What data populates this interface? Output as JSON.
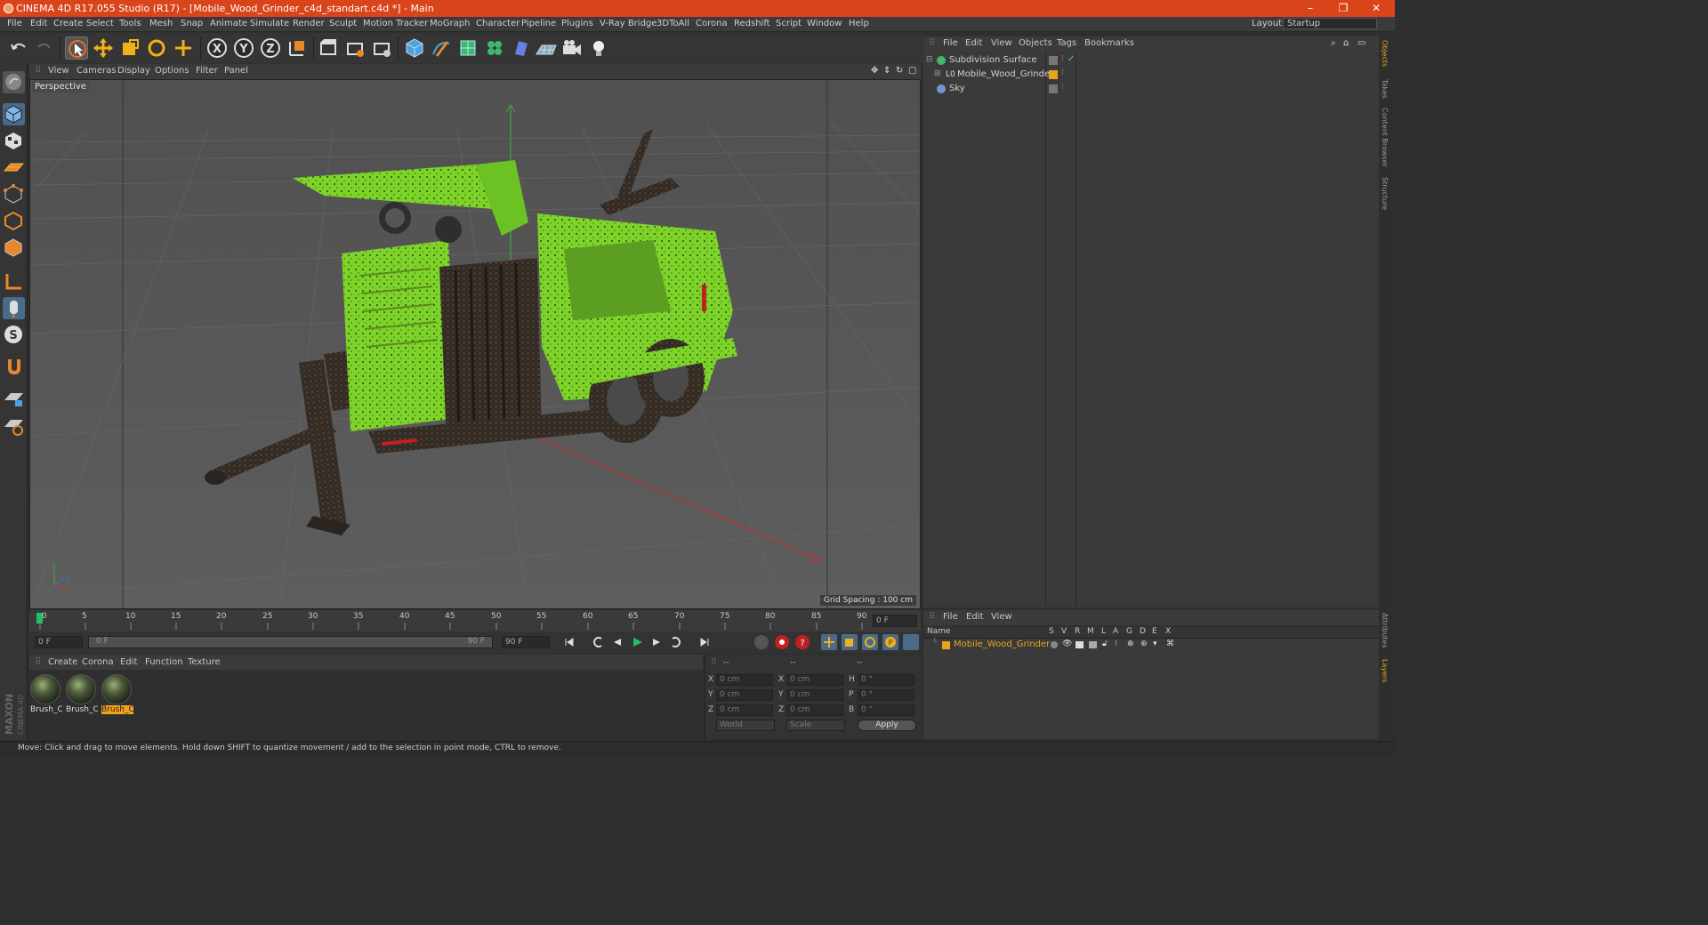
{
  "window": {
    "title": "CINEMA 4D R17.055 Studio (R17) - [Mobile_Wood_Grinder_c4d_standart.c4d *] - Main",
    "controls": [
      "–",
      "❐",
      "✕"
    ]
  },
  "menubar": {
    "items": [
      "File",
      "Edit",
      "Create",
      "Select",
      "Tools",
      "Mesh",
      "Snap",
      "Animate",
      "Simulate",
      "Render",
      "Sculpt",
      "Motion Tracker",
      "MoGraph",
      "Character",
      "Pipeline",
      "Plugins",
      "V-Ray Bridge",
      "3DToAll",
      "Corona",
      "Redshift",
      "Script",
      "Window",
      "Help"
    ],
    "layout_label": "Layout:",
    "layout_value": "Startup"
  },
  "toolbar": {
    "axis_x": "X",
    "axis_y": "Y",
    "axis_z": "Z"
  },
  "viewport": {
    "menu": [
      "View",
      "Cameras",
      "Display",
      "Options",
      "Filter",
      "Panel"
    ],
    "camera_label": "Perspective",
    "grid_spacing": "Grid Spacing : 100 cm"
  },
  "timeline": {
    "ticks": [
      "0",
      "5",
      "10",
      "15",
      "20",
      "25",
      "30",
      "35",
      "40",
      "45",
      "50",
      "55",
      "60",
      "65",
      "70",
      "75",
      "80",
      "85",
      "90"
    ],
    "current_frame_field": "0 F",
    "start_field": "0 F",
    "range_start": "0 F",
    "range_end": "90 F",
    "end_field": "90 F"
  },
  "materials": {
    "menu": [
      "Create",
      "Corona",
      "Edit",
      "Function",
      "Texture"
    ],
    "items": [
      {
        "label": "Brush_C",
        "selected": false
      },
      {
        "label": "Brush_C",
        "selected": false
      },
      {
        "label": "Brush_C",
        "selected": true
      }
    ]
  },
  "coordinates": {
    "headers": [
      "--",
      "--",
      "--"
    ],
    "rows": [
      {
        "l1": "X",
        "v1": "0 cm",
        "l2": "X",
        "v2": "0 cm",
        "l3": "H",
        "v3": "0 °"
      },
      {
        "l1": "Y",
        "v1": "0 cm",
        "l2": "Y",
        "v2": "0 cm",
        "l3": "P",
        "v3": "0 °"
      },
      {
        "l1": "Z",
        "v1": "0 cm",
        "l2": "Z",
        "v2": "0 cm",
        "l3": "B",
        "v3": "0 °"
      }
    ],
    "mode_world": "World",
    "mode_scale": "Scale",
    "apply": "Apply"
  },
  "object_manager": {
    "menu": [
      "File",
      "Edit",
      "View",
      "Objects",
      "Tags",
      "Bookmarks"
    ],
    "objects": [
      {
        "name": "Subdivision Surface",
        "icon": "subdivision-icon"
      },
      {
        "name": "Mobile_Wood_Grinder",
        "icon": "null-icon"
      },
      {
        "name": "Sky",
        "icon": "sky-icon"
      }
    ]
  },
  "layer_manager": {
    "menu": [
      "File",
      "Edit",
      "View"
    ],
    "columns": [
      "Name",
      "S",
      "V",
      "R",
      "M",
      "L",
      "A",
      "G",
      "D",
      "E",
      "X"
    ],
    "layer": "Mobile_Wood_Grinder"
  },
  "side_tabs": [
    "Objects",
    "Takes",
    "Content Browser",
    "Structure",
    "Attributes",
    "Layers"
  ],
  "statusbar": "Move: Click and drag to move elements. Hold down SHIFT to quantize movement / add to the selection in point mode, CTRL to remove.",
  "branding": {
    "line1": "MAXON",
    "line2": "CINEMA 4D"
  },
  "colors": {
    "accent": "#d9441b",
    "model": "#7fd22a",
    "selection": "#f2a11a"
  }
}
